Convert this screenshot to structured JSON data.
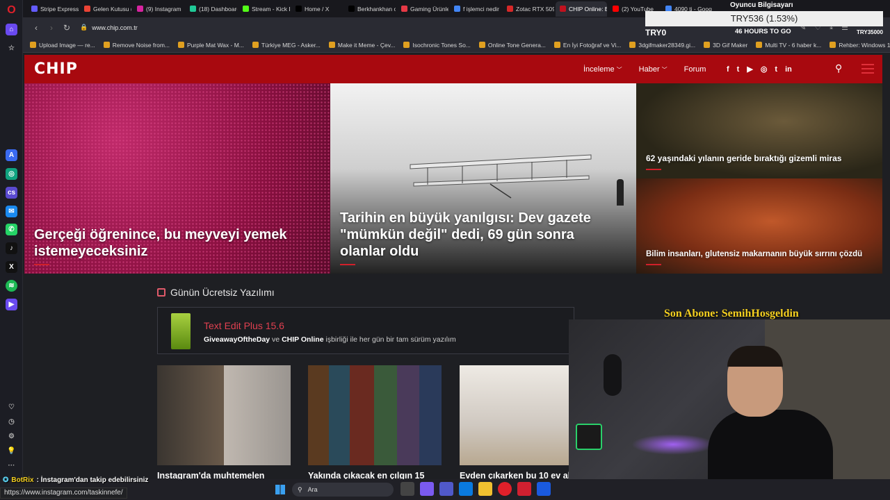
{
  "tabs": [
    {
      "label": "Stripe Express",
      "color": "#635bff"
    },
    {
      "label": "Gelen Kutusu (",
      "color": "#ea4335"
    },
    {
      "label": "(9) Instagram",
      "color": "#d6249f"
    },
    {
      "label": "(18) Dashboard",
      "color": "#20c997"
    },
    {
      "label": "Stream - Kick D",
      "color": "#53fc18"
    },
    {
      "label": "Home / X",
      "color": "#000000"
    },
    {
      "label": "Berkhankhan o",
      "color": "#000000"
    },
    {
      "label": "Gaming Ürünle",
      "color": "#e63946"
    },
    {
      "label": "f işlemci nedir",
      "color": "#4285f4"
    },
    {
      "label": "Zotac RTX 509",
      "color": "#d62828"
    },
    {
      "label": "CHIP Online: Bilişim ve Te",
      "color": "#c1121f"
    },
    {
      "label": "(2) YouTube",
      "color": "#ff0000"
    },
    {
      "label": "4090 ti - Goog",
      "color": "#4285f4"
    }
  ],
  "address": {
    "url": "www.chip.com.tr"
  },
  "bookmarks": [
    "Upload Image — re...",
    "Remove Noise from...",
    "Purple Mat Wax - M...",
    "Türkiye MEG - Asker...",
    "Make it Meme - Çev...",
    "Isochronic Tones So...",
    "Online Tone Genera...",
    "En İyi Fotoğraf ve Vi...",
    "3dgifmaker28349.gi...",
    "3D Gif Maker",
    "Multi TV - 6 haber k...",
    "Rehber: Windows 1..."
  ],
  "site": {
    "logo": "CHIP",
    "nav": {
      "inceleme": "İnceleme",
      "haber": "Haber",
      "forum": "Forum"
    },
    "social": [
      "f",
      "t",
      "▶",
      "◎",
      "t",
      "in"
    ]
  },
  "hero": {
    "h1": "Gerçeği öğrenince, bu meyveyi yemek istemeyeceksiniz",
    "h2": "Tarihin en büyük yanılgısı: Dev gazete \"mümkün değil\" dedi, 69 gün sonra olanlar oldu",
    "h3": "62 yaşındaki yılanın geride bıraktığı gizemli miras",
    "h4": "Bilim insanları, glutensiz makarnanın büyük sırrını çözdü"
  },
  "free_software": {
    "heading": "Günün Ücretsiz Yazılımı",
    "title": "Text Edit Plus 15.6",
    "sub_a": "GiveawayOftheDay",
    "sub_b": " ve ",
    "sub_c": "CHIP Online",
    "sub_d": " işbirliği ile her gün bir tam sürüm yazılım"
  },
  "articles": [
    "Instagram'da muhtemelen",
    "Yakında çıkacak en çılgın 15",
    "Evden çıkarken bu 10 ev al"
  ],
  "overlay": {
    "ticker_top": "Oyuncu Bilgisayarı",
    "ticker": "TRY536 (1.53%)",
    "ticker_left": "TRY0",
    "ticker_sub": "46 HOURS TO GO",
    "ticker_right": "TRY35000",
    "last_sub": "Son Abone: SemihHosgeldin",
    "bot_name": "BotRix",
    "bot_msg": ": İnstagram'dan takip edebilirsiniz"
  },
  "taskbar": {
    "search_placeholder": "Ara"
  },
  "status_url": "https://www.instagram.com/taskinnefe/"
}
